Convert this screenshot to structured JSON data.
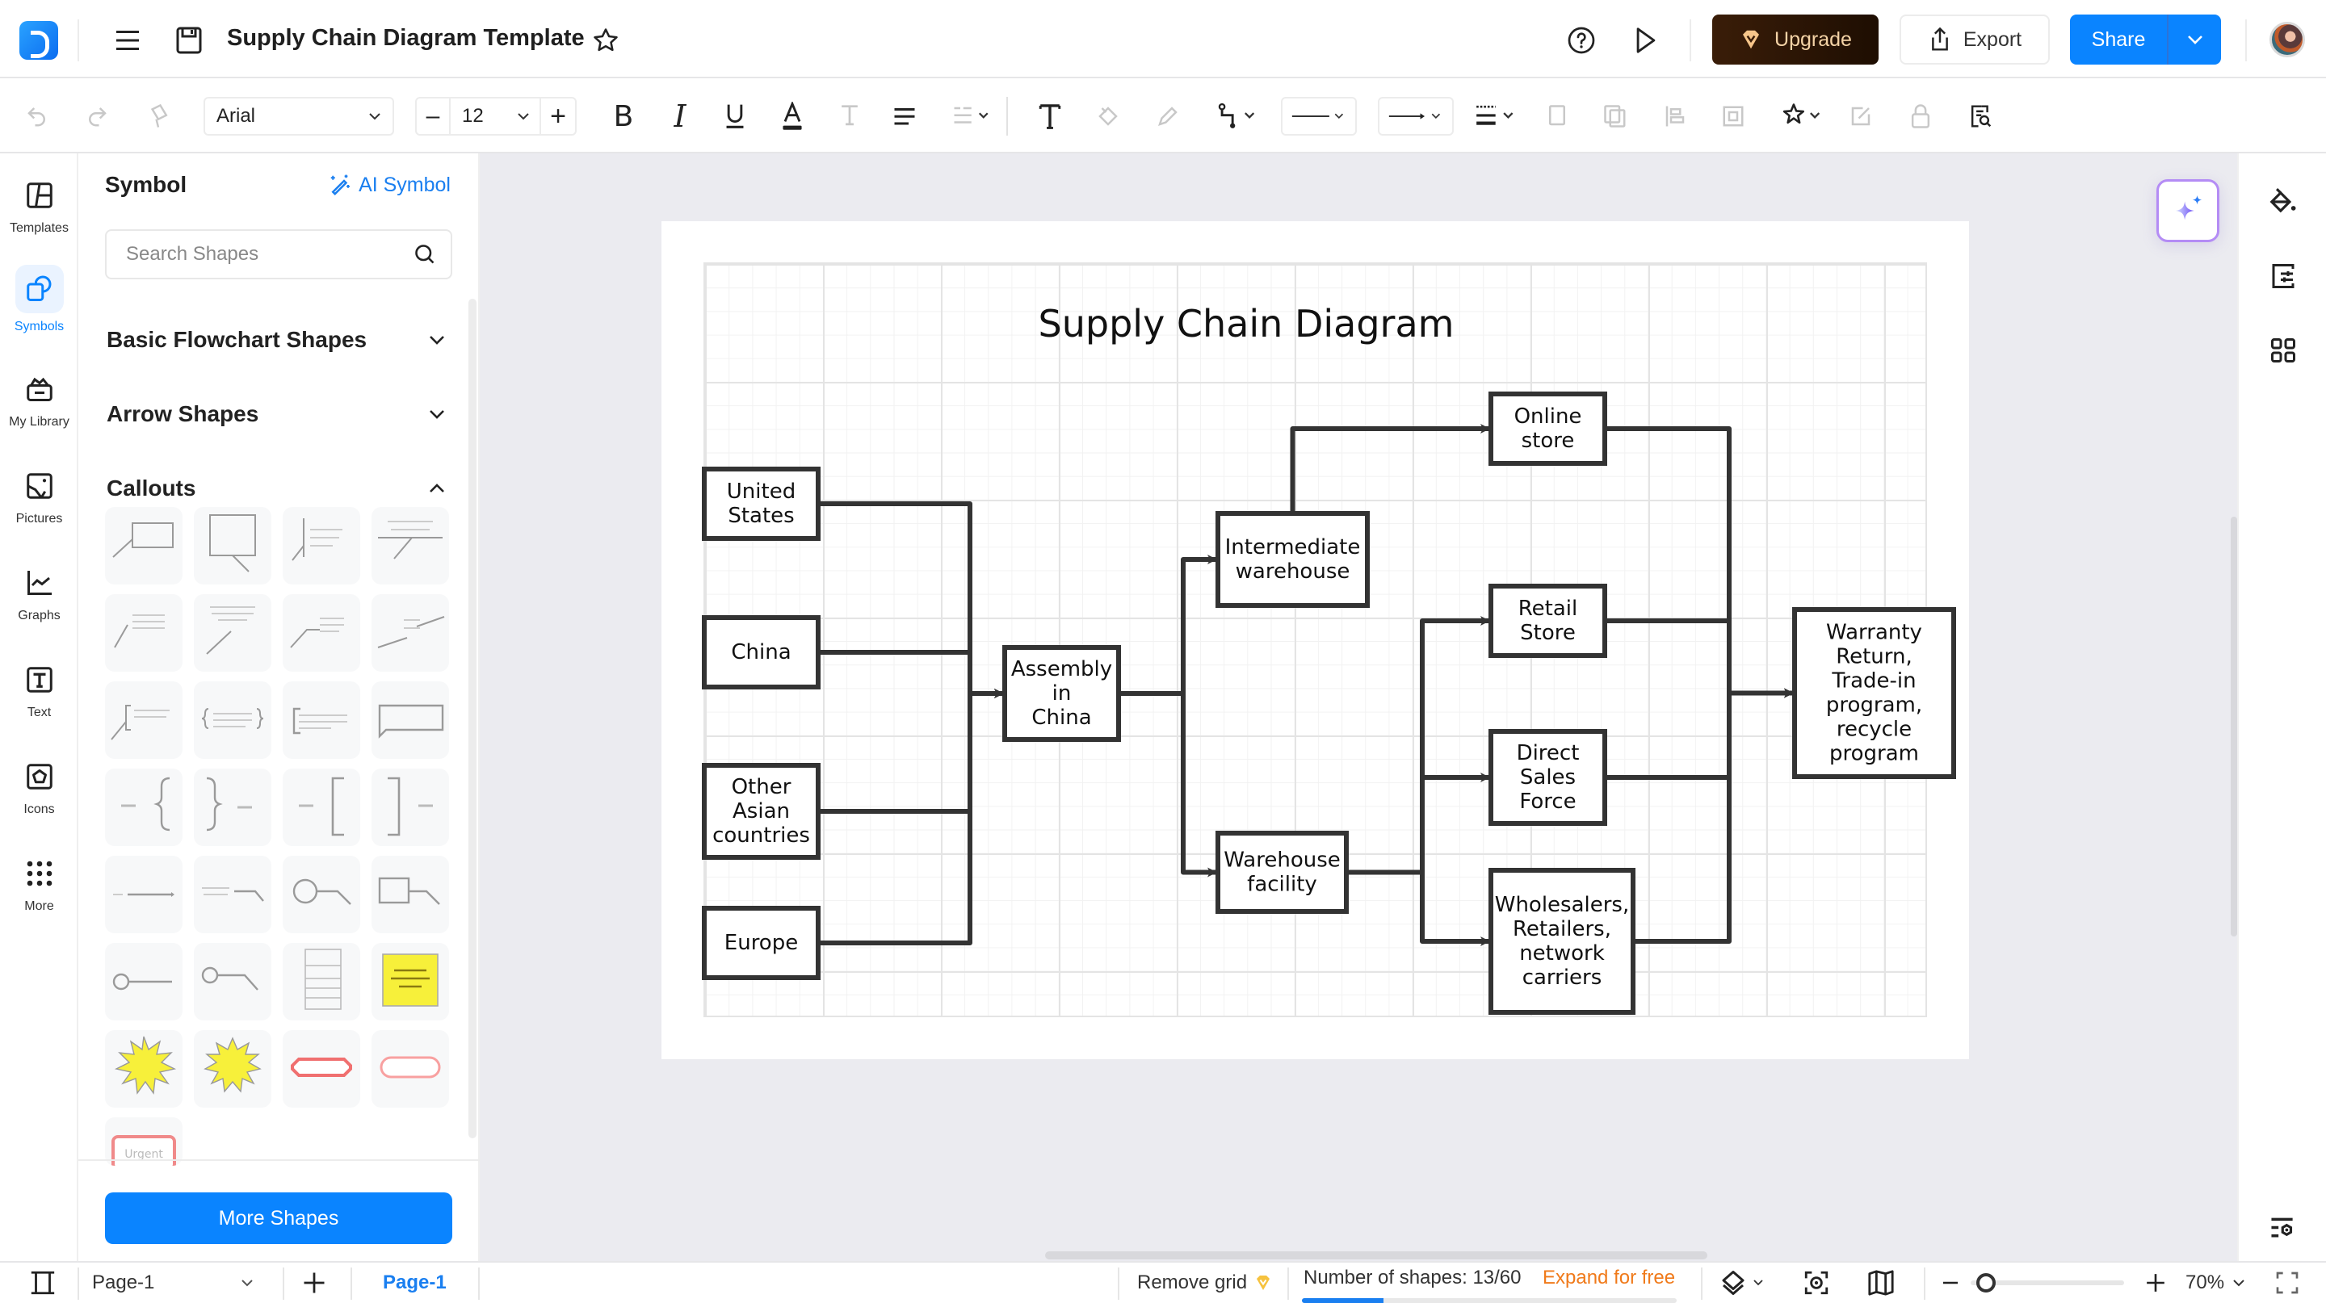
{
  "app": {
    "document_title": "Supply Chain Diagram Template",
    "buttons": {
      "upgrade": "Upgrade",
      "export": "Export",
      "share": "Share"
    },
    "accent_color": "#0a84ff",
    "upgrade_color": "#2a1405"
  },
  "toolbar": {
    "font_family": "Arial",
    "font_size": "12",
    "icons": [
      "undo-icon",
      "redo-icon",
      "format-painter-icon",
      "bold-icon",
      "italic-icon",
      "underline-icon",
      "font-color-icon",
      "text-style-icon",
      "align-icon",
      "line-spacing-icon",
      "text-icon",
      "fill-icon",
      "pen-icon",
      "connector-icon",
      "line-style-icon",
      "arrow-style-icon",
      "line-weight-icon",
      "bring-front-icon",
      "send-back-icon",
      "align-shapes-icon",
      "group-icon",
      "effects-icon",
      "edit-icon",
      "lock-icon",
      "find-icon"
    ]
  },
  "rail": {
    "items": [
      {
        "label": "Templates",
        "icon": "templates-icon",
        "active": false
      },
      {
        "label": "Symbols",
        "icon": "symbols-icon",
        "active": true
      },
      {
        "label": "My Library",
        "icon": "library-icon",
        "active": false
      },
      {
        "label": "Pictures",
        "icon": "pictures-icon",
        "active": false
      },
      {
        "label": "Graphs",
        "icon": "graphs-icon",
        "active": false
      },
      {
        "label": "Text",
        "icon": "text-icon",
        "active": false
      },
      {
        "label": "Icons",
        "icon": "icons-icon",
        "active": false
      },
      {
        "label": "More",
        "icon": "more-icon",
        "active": false
      }
    ]
  },
  "panel": {
    "title": "Symbol",
    "ai_symbol": "AI Symbol",
    "search_placeholder": "Search Shapes",
    "sections": [
      {
        "label": "Basic Flowchart Shapes",
        "expanded": false
      },
      {
        "label": "Arrow Shapes",
        "expanded": false
      },
      {
        "label": "Callouts",
        "expanded": true
      }
    ],
    "callout_tiles": [
      "rect-callout-line",
      "rect-callout-pointer",
      "line-callout-bar",
      "line-callout-top",
      "text-callout-line",
      "text-callout-line-2",
      "bent-line-callout",
      "double-line-callout",
      "bracket-callout-line",
      "brace-text-block",
      "bracket-text-block",
      "speech-bubble",
      "left-brace-label",
      "right-brace-label",
      "left-bracket-label",
      "right-bracket-label",
      "arrow-line-label",
      "bent-text-line",
      "circle-callout-bent",
      "rect-callout-bent",
      "circle-line",
      "circle-line-bent",
      "list-callout",
      "sticky-note",
      "starburst-yellow-1",
      "starburst-yellow-2",
      "red-octagon-tag",
      "red-rounded-tag",
      "urgent-tag"
    ],
    "urgent_label": "Urgent",
    "more_shapes": "More Shapes"
  },
  "diagram": {
    "title": "Supply Chain Diagram",
    "nodes": [
      {
        "id": "us",
        "lines": [
          "United",
          "States"
        ]
      },
      {
        "id": "china",
        "lines": [
          "China"
        ]
      },
      {
        "id": "asia",
        "lines": [
          "Other",
          "Asian",
          "countries"
        ]
      },
      {
        "id": "europe",
        "lines": [
          "Europe"
        ]
      },
      {
        "id": "assembly",
        "lines": [
          "Assembly",
          "in",
          "China"
        ]
      },
      {
        "id": "interwh",
        "lines": [
          "Intermediate",
          "warehouse"
        ]
      },
      {
        "id": "whfac",
        "lines": [
          "Warehouse",
          "facility"
        ]
      },
      {
        "id": "online",
        "lines": [
          "Online",
          "store"
        ]
      },
      {
        "id": "retail",
        "lines": [
          "Retail",
          "Store"
        ]
      },
      {
        "id": "direct",
        "lines": [
          "Direct",
          "Sales",
          "Force"
        ]
      },
      {
        "id": "wholesale",
        "lines": [
          "Wholesalers,",
          "Retailers,",
          "network",
          "carriers"
        ]
      },
      {
        "id": "warranty",
        "lines": [
          "Warranty",
          "Return,",
          "Trade-in",
          "program,",
          "recycle",
          "program"
        ]
      }
    ],
    "edges": [
      [
        "us",
        "assembly"
      ],
      [
        "china",
        "assembly"
      ],
      [
        "asia",
        "assembly"
      ],
      [
        "europe",
        "assembly"
      ],
      [
        "assembly",
        "interwh"
      ],
      [
        "assembly",
        "whfac"
      ],
      [
        "interwh",
        "online"
      ],
      [
        "whfac",
        "retail"
      ],
      [
        "whfac",
        "direct"
      ],
      [
        "whfac",
        "wholesale"
      ],
      [
        "online",
        "warranty"
      ],
      [
        "retail",
        "warranty"
      ],
      [
        "direct",
        "warranty"
      ],
      [
        "wholesale",
        "warranty"
      ]
    ]
  },
  "status": {
    "page_selector": "Page-1",
    "page_tab": "Page-1",
    "remove_grid": "Remove grid",
    "shape_count_label": "Number of shapes: 13/60",
    "shape_count": 13,
    "shape_limit": 60,
    "expand": "Expand for free",
    "zoom": "70%",
    "zoom_fraction": 0.1
  }
}
